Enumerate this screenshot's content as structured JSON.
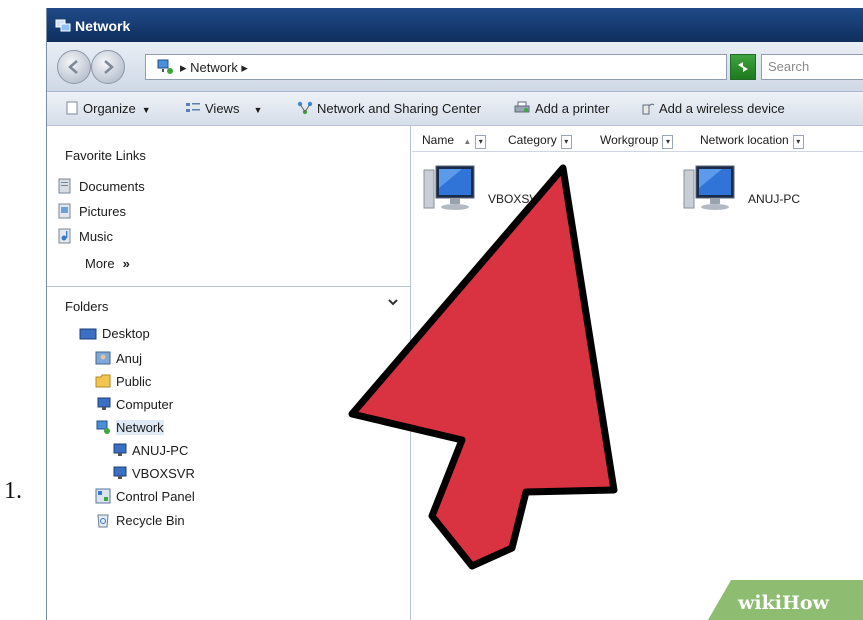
{
  "step": {
    "number": "1."
  },
  "window": {
    "title": "Network"
  },
  "address": {
    "breadcrumb": "▸ Network ▸",
    "search_placeholder": "Search"
  },
  "toolbar": {
    "organize": "Organize",
    "views": "Views",
    "network_center": "Network and Sharing Center",
    "add_printer": "Add a printer",
    "add_wireless": "Add a wireless device"
  },
  "favorites": {
    "title": "Favorite Links",
    "items": [
      {
        "label": "Documents",
        "icon": "documents-icon"
      },
      {
        "label": "Pictures",
        "icon": "pictures-icon"
      },
      {
        "label": "Music",
        "icon": "music-icon"
      }
    ],
    "more": "More",
    "more_chevron": "»"
  },
  "folders": {
    "title": "Folders",
    "tree": [
      {
        "label": "Desktop",
        "icon": "desktop-icon"
      },
      {
        "label": "Anuj",
        "icon": "user-folder-icon"
      },
      {
        "label": "Public",
        "icon": "folder-icon"
      },
      {
        "label": "Computer",
        "icon": "computer-icon"
      },
      {
        "label": "Network",
        "icon": "network-icon"
      },
      {
        "label": "ANUJ-PC",
        "icon": "computer-icon"
      },
      {
        "label": "VBOXSVR",
        "icon": "computer-icon"
      },
      {
        "label": "Control Panel",
        "icon": "control-panel-icon"
      },
      {
        "label": "Recycle Bin",
        "icon": "recycle-bin-icon"
      }
    ]
  },
  "columns": [
    {
      "label": "Name"
    },
    {
      "label": "Category"
    },
    {
      "label": "Workgroup"
    },
    {
      "label": "Network location"
    }
  ],
  "network_items": [
    {
      "label": "VBOXSVR"
    },
    {
      "label": "ANUJ-PC"
    }
  ],
  "watermark": {
    "prefix": "wiki",
    "suffix": "How"
  },
  "colors": {
    "arrow": "#d93240",
    "titlebar": "#1f4a86",
    "watermark": "#8ebc70"
  }
}
